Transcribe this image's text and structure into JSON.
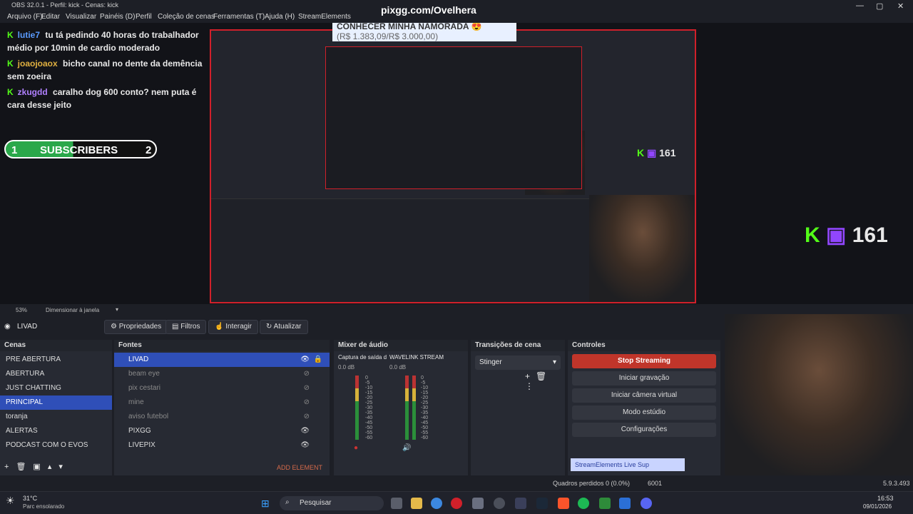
{
  "window": {
    "title": "OBS 32.0.1 - Perfil: kick - Cenas: kick"
  },
  "menu": [
    "Arquivo (F)",
    "Editar",
    "Visualizar",
    "Painéis (D)",
    "Perfil",
    "Coleção de cenas",
    "Ferramentas (T)",
    "Ajuda (H)",
    "StreamElements"
  ],
  "overlay": {
    "url": "pixgg.com/Ovelhera"
  },
  "chat": [
    {
      "user": "lutie7",
      "user_color": "#5a9bff",
      "text": "tu tá pedindo 40 horas do trabalhador médio por 10min de cardio moderado"
    },
    {
      "user": "joaojoaox",
      "user_color": "#e0b040",
      "text": "bicho canal no dente da demência sem zoeira"
    },
    {
      "user": "zkugdd",
      "user_color": "#b080ff",
      "text": "caralho dog 600 conto? nem puta é cara desse jeito"
    }
  ],
  "subscribers": {
    "left": "1",
    "label": "SUBSCRIBERS",
    "right": "2"
  },
  "goal_banner": {
    "title": "CONHECER MINHA NAMORADA 😍",
    "amount": "(R$ 1.383,09/R$ 3.000,00)"
  },
  "viewer_count": "161",
  "preview_footer": {
    "zoom": "53%",
    "fit_label": "Dimensionar à janela"
  },
  "source_toolbar": {
    "scene_name": "LIVAD",
    "buttons": [
      "Propriedades",
      "Filtros",
      "Interagir",
      "Atualizar"
    ]
  },
  "docks": {
    "scenes": {
      "title": "Cenas",
      "items": [
        "PRE ABERTURA",
        "ABERTURA",
        "JUST CHATTING",
        "PRINCIPAL",
        "toranja",
        "ALERTAS",
        "PODCAST COM O EVOS"
      ],
      "selected": 3
    },
    "sources": {
      "title": "Fontes",
      "items": [
        {
          "name": "LIVAD",
          "visible": true,
          "selected": true
        },
        {
          "name": "beam eye",
          "visible": false
        },
        {
          "name": "pix cestari",
          "visible": false
        },
        {
          "name": "mine",
          "visible": false
        },
        {
          "name": "aviso futebol",
          "visible": false
        },
        {
          "name": "PIXGG",
          "visible": true
        },
        {
          "name": "LIVEPIX",
          "visible": true
        }
      ],
      "add_label": "ADD ELEMENT"
    },
    "mixer": {
      "title": "Mixer de áudio",
      "channels": [
        {
          "name": "Captura de saída d",
          "db": "0.0 dB"
        },
        {
          "name": "WAVELINK STREAM",
          "db": "0.0 dB"
        }
      ],
      "ticks": [
        "0",
        "-5",
        "-10",
        "-15",
        "-20",
        "-25",
        "-30",
        "-35",
        "-40",
        "-45",
        "-50",
        "-55",
        "-60"
      ]
    },
    "transitions": {
      "title": "Transições de cena",
      "selected": "Stinger"
    },
    "controls": {
      "title": "Controles",
      "buttons": [
        "Stop Streaming",
        "Iniciar gravação",
        "Iniciar câmera virtual",
        "Modo estúdio",
        "Configurações"
      ],
      "se_label": "StreamElements Live Sup"
    }
  },
  "status": {
    "dropped": "Quadros perdidos 0 (0.0%)",
    "bitrate": "6001",
    "version": "5.9.3.493"
  },
  "taskbar": {
    "weather": {
      "temp": "31°C",
      "desc": "Parc ensolarado"
    },
    "search": "Pesquisar",
    "time": "16:53",
    "date": "09/01/2026"
  }
}
